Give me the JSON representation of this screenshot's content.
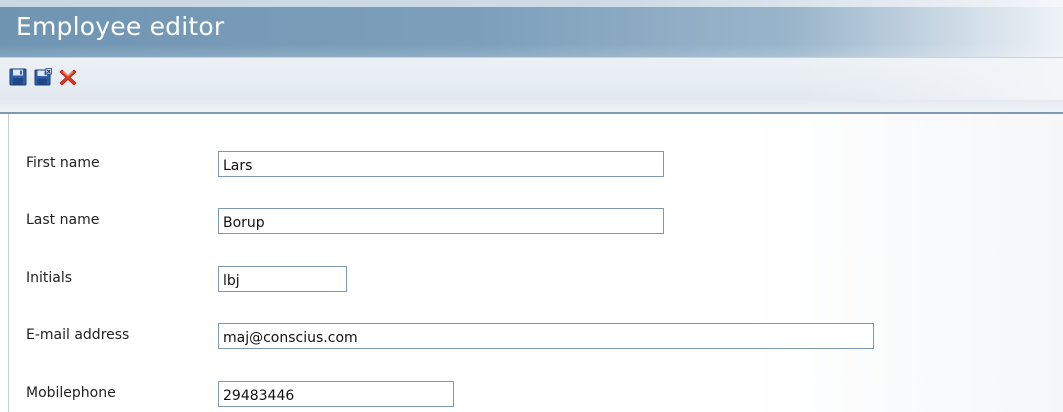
{
  "window": {
    "title": "Employee editor"
  },
  "toolbar": {
    "buttons": [
      {
        "icon": "floppy-disk-icon",
        "action": "save"
      },
      {
        "icon": "floppy-disk-close-icon",
        "action": "save-and-close"
      },
      {
        "icon": "red-x-icon",
        "action": "cancel"
      }
    ]
  },
  "form": {
    "first_name": {
      "label": "First name",
      "value": "Lars"
    },
    "last_name": {
      "label": "Last name",
      "value": "Borup"
    },
    "initials": {
      "label": "Initials",
      "value": "lbj"
    },
    "email": {
      "label": "E-mail address",
      "value": "maj@conscius.com"
    },
    "mobilephone": {
      "label": "Mobilephone",
      "value": "29483446"
    }
  },
  "colors": {
    "titlebar": "#7d9fbb",
    "title_text": "#ffffff",
    "field_border": "#7d98af",
    "delete_icon": "#e03a1e"
  }
}
